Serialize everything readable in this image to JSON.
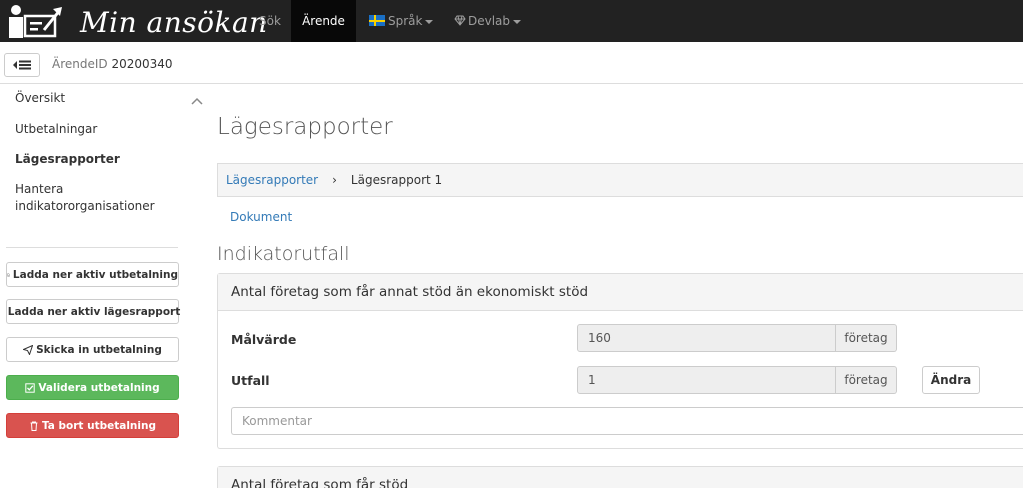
{
  "navbar": {
    "brand": "Min ansökan",
    "items": [
      {
        "label": "Sök"
      },
      {
        "label": "Ärende"
      },
      {
        "label": "Språk"
      },
      {
        "label": "Devlab"
      }
    ]
  },
  "subheader": {
    "arende_label": "ÄrendeID",
    "arende_value": "20200340"
  },
  "sidebar": {
    "links": [
      {
        "label": "Översikt"
      },
      {
        "label": "Utbetalningar"
      },
      {
        "label": "Lägesrapporter"
      },
      {
        "label": "Hantera indikatororganisationer"
      }
    ],
    "buttons": [
      {
        "label": "Ladda ner aktiv utbetalning"
      },
      {
        "label": "Ladda ner aktiv lägesrapport"
      },
      {
        "label": "Skicka in utbetalning"
      },
      {
        "label": "Validera utbetalning"
      },
      {
        "label": "Ta bort utbetalning"
      }
    ]
  },
  "main": {
    "title": "Lägesrapporter",
    "breadcrumb": {
      "link": "Lägesrapporter",
      "separator": "›",
      "current": "Lägesrapport 1"
    },
    "doc_link": "Dokument",
    "section_title": "Indikatorutfall",
    "panels": [
      {
        "heading": "Antal företag som får annat stöd än ekonomiskt stöd",
        "target_label": "Målvärde",
        "target_value": "160",
        "target_unit": "företag",
        "outcome_label": "Utfall",
        "outcome_value": "1",
        "outcome_unit": "företag",
        "change_label": "Ändra",
        "comment_placeholder": "Kommentar"
      },
      {
        "heading": "Antal företag som får stöd"
      }
    ]
  },
  "colors": {
    "navbar_bg": "#222222",
    "active_nav_bg": "#080808",
    "link": "#337ab7",
    "success": "#5cb85c",
    "danger": "#d9534f"
  }
}
